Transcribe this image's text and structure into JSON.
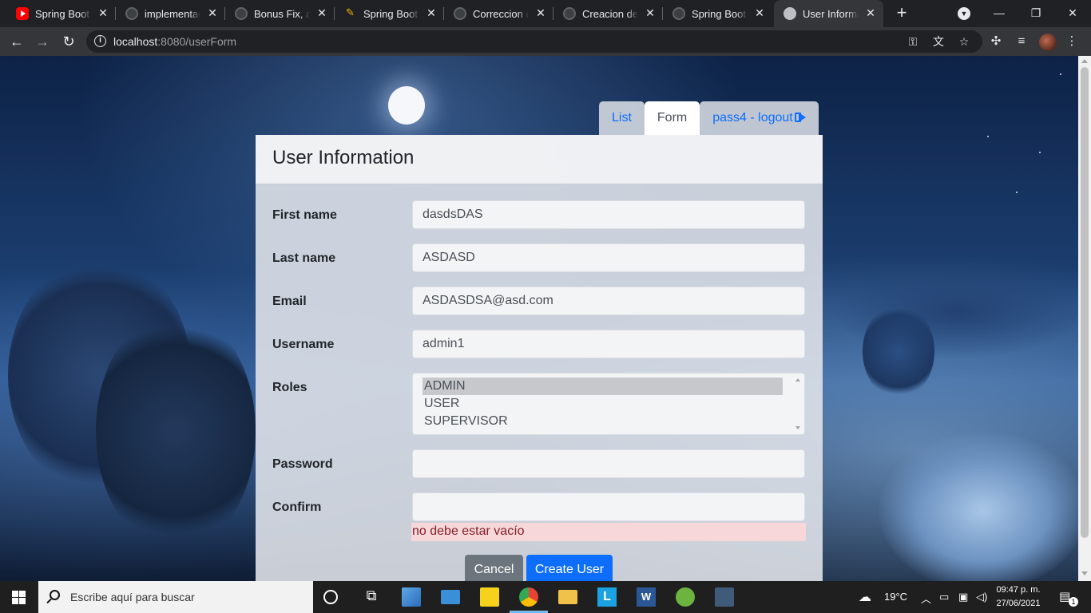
{
  "browser": {
    "tabs": [
      {
        "title": "Spring Boot A",
        "icon": "youtube-icon"
      },
      {
        "title": "implementació",
        "icon": "github-icon"
      },
      {
        "title": "Bonus Fix, agr",
        "icon": "github-icon"
      },
      {
        "title": "Spring Boot A",
        "icon": "pen-icon"
      },
      {
        "title": "Correccion de",
        "icon": "github-icon"
      },
      {
        "title": "Creacion de p",
        "icon": "github-icon"
      },
      {
        "title": "Spring Boot A",
        "icon": "github-icon"
      },
      {
        "title": "User Informat",
        "icon": "globe-icon",
        "active": true
      }
    ],
    "url_host": "localhost",
    "url_rest": ":8080/userForm"
  },
  "nav": {
    "list_label": "List",
    "form_label": "Form",
    "logout_label": "pass4 - logout"
  },
  "card": {
    "title": "User Information"
  },
  "form": {
    "first_name": {
      "label": "First name",
      "value": "dasdsDAS"
    },
    "last_name": {
      "label": "Last name",
      "value": "ASDASD"
    },
    "email": {
      "label": "Email",
      "value": "ASDASDSA@asd.com"
    },
    "username": {
      "label": "Username",
      "value": "admin1"
    },
    "roles": {
      "label": "Roles",
      "options": [
        "ADMIN",
        "USER",
        "SUPERVISOR"
      ],
      "selected": "ADMIN"
    },
    "password": {
      "label": "Password",
      "value": ""
    },
    "confirm": {
      "label": "Confirm",
      "value": "",
      "error": "no debe estar vacío"
    },
    "cancel_label": "Cancel",
    "submit_label": "Create User"
  },
  "taskbar": {
    "search_placeholder": "Escribe aquí para buscar",
    "weather": "19°C",
    "time": "09:47 p. m.",
    "date": "27/06/2021",
    "notifications": "1"
  },
  "colors": {
    "primary": "#0d6efd",
    "secondary": "#6c757d",
    "danger_bg": "#f7d7da",
    "danger_text": "#842029"
  }
}
